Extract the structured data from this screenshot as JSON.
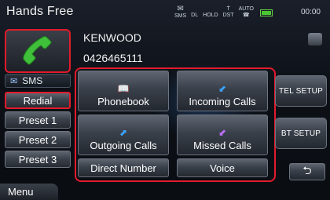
{
  "header": {
    "title": "Hands Free",
    "status_sms": "SMS",
    "status_dl": "DL",
    "status_hold": "HOLD",
    "status_dst": "DST",
    "status_auto": "AUTO",
    "clock": "00:00"
  },
  "contact": {
    "name": "KENWOOD",
    "number": "0426465111"
  },
  "left": {
    "sms_label": "SMS",
    "redial": "Redial",
    "preset1": "Preset 1",
    "preset2": "Preset 2",
    "preset3": "Preset 3"
  },
  "grid": {
    "phonebook": "Phonebook",
    "incoming": "Incoming Calls",
    "outgoing": "Outgoing Calls",
    "missed": "Missed Calls",
    "direct": "Direct Number",
    "voice": "Voice"
  },
  "right": {
    "tel_setup": "TEL SETUP",
    "bt_setup": "BT SETUP"
  },
  "footer": {
    "menu": "Menu"
  },
  "icons": {
    "phone": "phone-handset-icon",
    "phonebook": "book-icon",
    "incoming": "incoming-call-icon",
    "outgoing": "outgoing-call-icon",
    "missed": "missed-call-icon",
    "back": "return-arrow-icon"
  },
  "colors": {
    "highlight": "#e21b2c",
    "phone_green": "#3fbf3a",
    "battery": "#4bc432"
  }
}
